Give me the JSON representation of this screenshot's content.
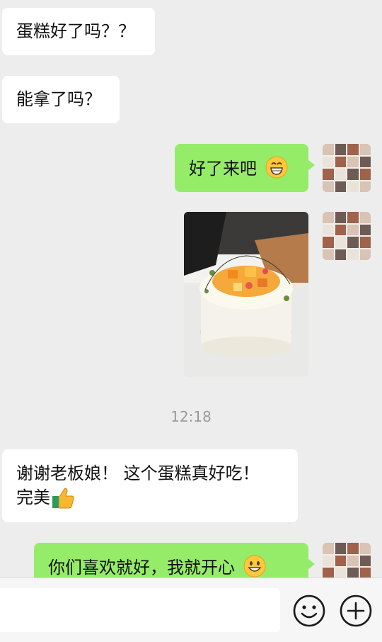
{
  "messages": {
    "m1": "蛋糕好了吗？？",
    "m2": "能拿了吗？",
    "m3": "好了来吧",
    "m4_line1": "谢谢老板娘！ 这个蛋糕真好吃！",
    "m4_line2": "完美",
    "m5": "你们喜欢就好，我就开心"
  },
  "timestamp": "12:18",
  "icons": {
    "grin": "grinning-face-emoji",
    "thumbs": "thumbs-up-emoji",
    "smile": "smiling-face-emoji",
    "emoji_button": "emoji-face-icon",
    "plus_button": "plus-circle-icon"
  },
  "colors": {
    "background": "#ededed",
    "outgoing_bubble": "#95ec69",
    "incoming_bubble": "#ffffff",
    "timestamp_text": "#9a9a9a",
    "input_bar": "#f6f6f6"
  },
  "input": {
    "placeholder": ""
  }
}
